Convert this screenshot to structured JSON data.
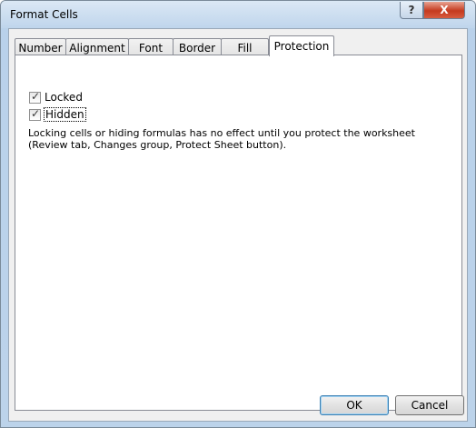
{
  "window": {
    "title": "Format Cells",
    "help_icon": "?",
    "close_icon": "X"
  },
  "tabs": [
    {
      "label": "Number"
    },
    {
      "label": "Alignment"
    },
    {
      "label": "Font"
    },
    {
      "label": "Border"
    },
    {
      "label": "Fill"
    },
    {
      "label": "Protection"
    }
  ],
  "protection": {
    "locked_label": "Locked",
    "locked_checked": true,
    "hidden_label": "Hidden",
    "hidden_checked": true,
    "info_text": "Locking cells or hiding formulas has no effect until you protect the worksheet (Review tab, Changes group, Protect Sheet button)."
  },
  "buttons": {
    "ok_label": "OK",
    "cancel_label": "Cancel"
  }
}
